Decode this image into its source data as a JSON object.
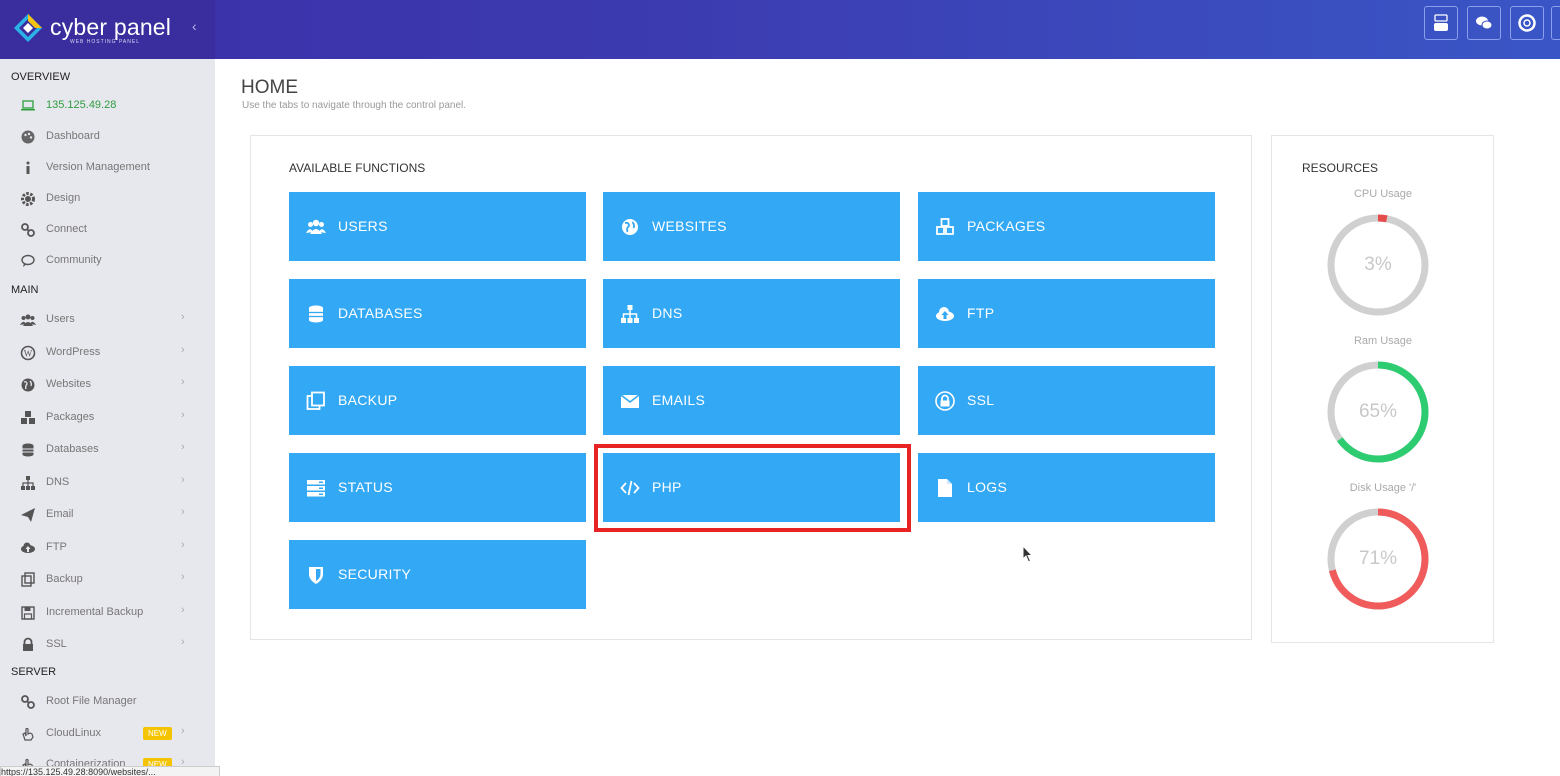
{
  "brand": {
    "name": "cyber panel",
    "sub": "WEB HOSTING PANEL"
  },
  "header": {
    "icons": [
      "youtube-icon",
      "chat-icon",
      "support-icon"
    ]
  },
  "sidebar": {
    "overview_label": "OVERVIEW",
    "main_label": "MAIN",
    "server_label": "SERVER",
    "ip": "135.125.49.28",
    "overview_items": [
      {
        "label": "Dashboard",
        "icon": "palette-icon"
      },
      {
        "label": "Version Management",
        "icon": "info-icon"
      },
      {
        "label": "Design",
        "icon": "gear-icon"
      },
      {
        "label": "Connect",
        "icon": "link-icon"
      },
      {
        "label": "Community",
        "icon": "comment-icon"
      }
    ],
    "main_items": [
      {
        "label": "Users",
        "icon": "users-icon"
      },
      {
        "label": "WordPress",
        "icon": "wordpress-icon"
      },
      {
        "label": "Websites",
        "icon": "globe-icon"
      },
      {
        "label": "Packages",
        "icon": "cubes-icon"
      },
      {
        "label": "Databases",
        "icon": "database-icon"
      },
      {
        "label": "DNS",
        "icon": "sitemap-icon"
      },
      {
        "label": "Email",
        "icon": "paper-plane-icon"
      },
      {
        "label": "FTP",
        "icon": "cloud-upload-icon"
      },
      {
        "label": "Backup",
        "icon": "copy-icon"
      },
      {
        "label": "Incremental Backup",
        "icon": "save-icon"
      },
      {
        "label": "SSL",
        "icon": "lock-icon"
      }
    ],
    "server_items": [
      {
        "label": "Root File Manager",
        "icon": "link-icon"
      },
      {
        "label": "CloudLinux",
        "icon": "cloud-hand-icon",
        "badge": "NEW"
      },
      {
        "label": "Containerization",
        "icon": "container-icon",
        "badge": "NEW"
      }
    ]
  },
  "page": {
    "title": "HOME",
    "subtitle": "Use the tabs to navigate through the control panel."
  },
  "functions": {
    "title": "AVAILABLE FUNCTIONS",
    "items": [
      {
        "label": "USERS",
        "icon": "users-icon"
      },
      {
        "label": "WEBSITES",
        "icon": "globe-icon"
      },
      {
        "label": "PACKAGES",
        "icon": "cubes-icon"
      },
      {
        "label": "DATABASES",
        "icon": "database-icon"
      },
      {
        "label": "DNS",
        "icon": "sitemap-icon"
      },
      {
        "label": "FTP",
        "icon": "cloud-upload-icon"
      },
      {
        "label": "BACKUP",
        "icon": "copy-icon"
      },
      {
        "label": "EMAILS",
        "icon": "envelope-icon"
      },
      {
        "label": "SSL",
        "icon": "lock-icon"
      },
      {
        "label": "STATUS",
        "icon": "server-icon"
      },
      {
        "label": "PHP",
        "icon": "code-icon"
      },
      {
        "label": "LOGS",
        "icon": "file-icon"
      },
      {
        "label": "SECURITY",
        "icon": "shield-icon"
      }
    ],
    "highlighted": "PHP"
  },
  "resources": {
    "title": "RESOURCES",
    "gauges": [
      {
        "label": "CPU Usage",
        "value": "3%",
        "percent": 3,
        "color": "#e74c4c"
      },
      {
        "label": "Ram Usage",
        "value": "65%",
        "percent": 65,
        "color": "#2ecc71"
      },
      {
        "label": "Disk Usage '/'",
        "value": "71%",
        "percent": 71,
        "color": "#f05b5b"
      }
    ]
  },
  "statusbar": {
    "url": "https://135.125.49.28:8090/websites/..."
  },
  "colors": {
    "accent": "#33a8f5",
    "header": "#3b2fa8",
    "highlight": "#e82323",
    "ip": "#2e9e3e"
  }
}
